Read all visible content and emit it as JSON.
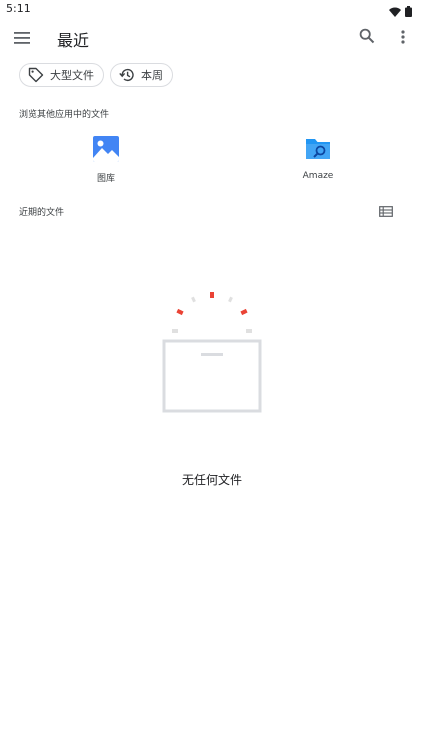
{
  "status_bar": {
    "time": "5:11",
    "icons": [
      "wifi-icon",
      "battery-icon"
    ]
  },
  "app_bar": {
    "title": "最近",
    "icons": [
      "menu-icon",
      "search-icon",
      "more-vert-icon"
    ]
  },
  "chips": [
    {
      "label": "大型文件",
      "icon": "tag-icon"
    },
    {
      "label": "本周",
      "icon": "history-icon"
    }
  ],
  "browse_section": {
    "label": "浏览其他应用中的文件",
    "apps": [
      {
        "label": "图库",
        "icon": "gallery-icon"
      },
      {
        "label": "Amaze",
        "icon": "amaze-folder-icon"
      }
    ]
  },
  "recent_section": {
    "label": "近期的文件",
    "view_icon": "list-view-icon"
  },
  "empty_state": {
    "text": "无任何文件",
    "accent_color": "#ea4335"
  }
}
